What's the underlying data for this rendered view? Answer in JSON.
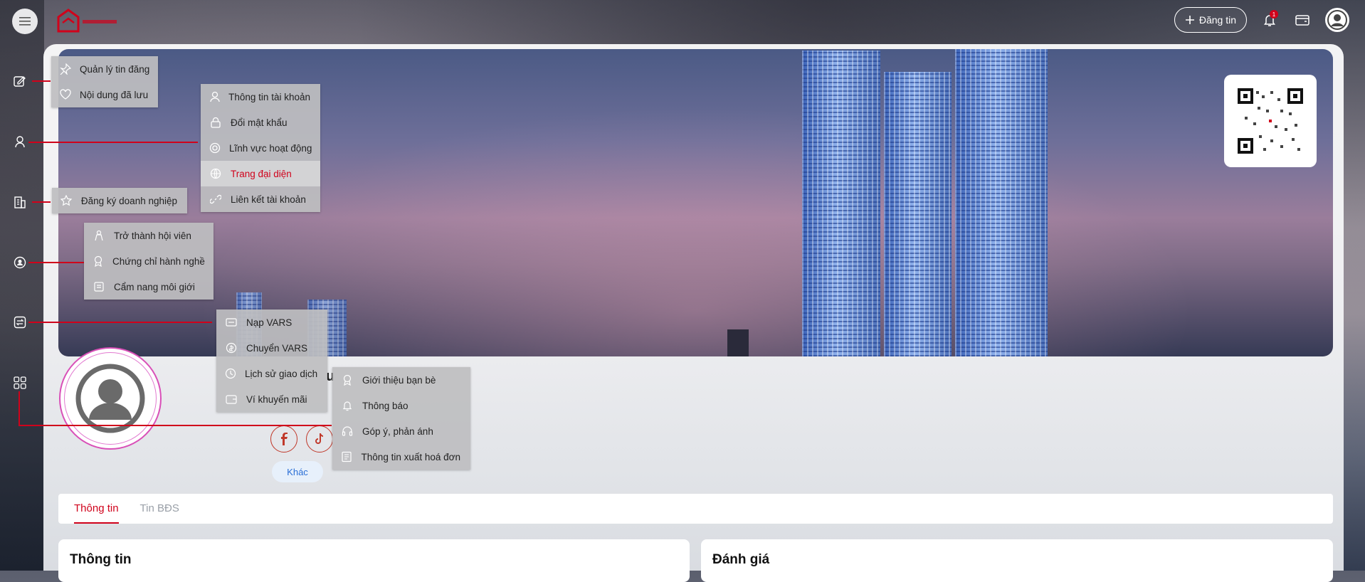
{
  "header": {
    "post_label": "Đăng tin",
    "notification_count": "1"
  },
  "menus": {
    "posts": [
      "Quản lý tin đăng",
      "Nội dung đã lưu"
    ],
    "account": [
      "Thông tin tài khoản",
      "Đổi mật khẩu",
      "Lĩnh vực hoạt động",
      "Trang đại diện",
      "Liên kết tài khoản"
    ],
    "business": [
      "Đăng ký doanh nghiệp"
    ],
    "broker": [
      "Trở thành hội viên",
      "Chứng chỉ hành nghề",
      "Cẩm nang môi giới"
    ],
    "vars": [
      "Nạp VARS",
      "Chuyển VARS",
      "Lịch sử giao dịch",
      "Ví khuyến mãi"
    ],
    "other": [
      "Giới thiệu bạn bè",
      "Thông báo",
      "Góp ý, phản ánh",
      "Thông tin xuất hoá đơn"
    ]
  },
  "active_menu_item": "Trang đại diện",
  "profile": {
    "other_button": "Khác",
    "name_fragment": "u"
  },
  "tabs": [
    "Thông tin",
    "Tin BĐS"
  ],
  "panels": {
    "info_title": "Thông tin",
    "rating_title": "Đánh giá"
  },
  "colors": {
    "accent": "#d0021b",
    "link": "#2b6fd6"
  },
  "icons": [
    "menu-icon",
    "plus-icon",
    "bell-icon",
    "wallet-icon",
    "user-icon",
    "facebook-icon",
    "tiktok-icon"
  ]
}
